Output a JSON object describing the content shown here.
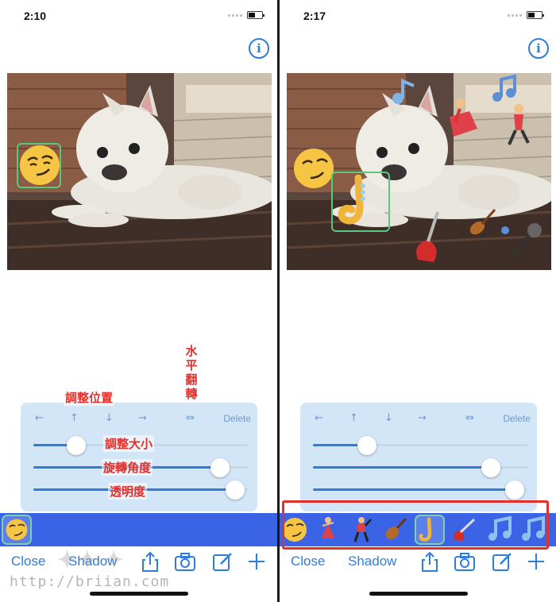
{
  "left": {
    "status": {
      "time": "2:10"
    },
    "controls": {
      "left_arrow": "←",
      "up_arrow": "↑",
      "down_arrow": "↓",
      "right_arrow": "→",
      "flip": "⇔",
      "delete": "Delete"
    },
    "sliders": {
      "size": 0.2,
      "rotation": 0.87,
      "opacity": 0.94
    },
    "annotations": {
      "adjust_position": "調整位置",
      "adjust_size": "調整大小",
      "rotation_angle": "旋轉角度",
      "opacity": "透明度",
      "horizontal_flip": [
        "水",
        "平",
        "翻",
        "轉"
      ]
    },
    "toolbar": {
      "close": "Close",
      "shadow": "Shadow"
    }
  },
  "right": {
    "status": {
      "time": "2:17"
    },
    "controls": {
      "left_arrow": "←",
      "up_arrow": "↑",
      "down_arrow": "↓",
      "right_arrow": "→",
      "flip": "⇔",
      "delete": "Delete"
    },
    "sliders": {
      "size": 0.25,
      "rotation": 0.83,
      "opacity": 0.94
    },
    "toolbar": {
      "close": "Close",
      "shadow": "Shadow"
    },
    "stickers": [
      "smirk-face",
      "dancing-woman",
      "dancing-man",
      "violin",
      "saxophone",
      "electric-guitar",
      "music-notes",
      "music-notes"
    ]
  },
  "watermark": "http://briian.com",
  "colors": {
    "accent": "#2f7ddb",
    "sticker_bar": "#3a63e6",
    "panel": "#d3e6f8",
    "annotation": "#e0322c",
    "selection": "#58c87a"
  }
}
